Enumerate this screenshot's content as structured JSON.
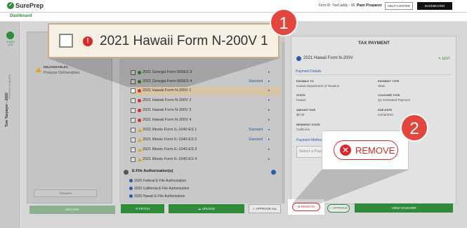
{
  "header": {
    "logo": "SurePrep",
    "firm_info": "Firm ID: TaxCaddy - 06",
    "user": "Pam Preparer",
    "help_center": "HELP CENTER",
    "dashboard": "DASHBOARD"
  },
  "subnav": {
    "dashboard_tab": "Dashboard"
  },
  "rail": {
    "client_list": "CLIENT LIST",
    "taxpayer": "Tom Taxpayer - 2020",
    "vertical_small": "PRINTING CHANGED"
  },
  "left": {
    "deliverables_title": "DELIVERABLES",
    "deliverables_sub": "Prepare Deliverables",
    "spinner_btn": "SPINNER",
    "deliver_btn": "DELIVER"
  },
  "list": {
    "rows": [
      {
        "label": "2021 Georgia Form 500ES 3",
        "status": "green",
        "std": "",
        "arrow": "▸"
      },
      {
        "label": "2021 Georgia Form 500ES 4",
        "status": "green",
        "std": "Standard",
        "arrow": "▸"
      },
      {
        "label": "2021 Hawaii Form N-200V 1",
        "status": "red",
        "std": "",
        "arrow": "▸"
      },
      {
        "label": "2021 Hawaii Form N-200V 2",
        "status": "red",
        "std": "",
        "arrow": "▸"
      },
      {
        "label": "2021 Hawaii Form N-200V 3",
        "status": "red",
        "std": "",
        "arrow": "▸"
      },
      {
        "label": "2021 Hawaii Form N-200V 4",
        "status": "red",
        "std": "",
        "arrow": "▸"
      },
      {
        "label": "2021 Illinois Form IL-1040-ES 1",
        "status": "warn",
        "std": "Standard",
        "arrow": "▸"
      },
      {
        "label": "2021 Illinois Form IL-1040-ES 2",
        "status": "warn",
        "std": "Standard",
        "arrow": "▸"
      },
      {
        "label": "2021 Illinois Form IL-1040-ES 3",
        "status": "warn",
        "std": "",
        "arrow": "▸"
      },
      {
        "label": "2021 Illinois Form IL-1040-ES 4",
        "status": "warn",
        "std": "",
        "arrow": "▸"
      }
    ],
    "efile_header": "E-File Authorization(s)",
    "efile_rows": [
      "2020 Federal E-File Authorization",
      "2020 California E-File Authorization",
      "2020 Hawaii E-File Authorization"
    ],
    "fetch": "FETCH",
    "upload": "UPLOAD",
    "approve_all": "APPROVE ALL"
  },
  "panel": {
    "title": "TAX PAYMENT",
    "form": "2021 Hawaii Form N-200V",
    "edit": "EDIT",
    "section": "Payment Details",
    "fields": [
      {
        "label": "PAYABLE TO",
        "value": "Hawaii Department of Taxation"
      },
      {
        "label": "PAYMENT TYPE",
        "value": "State"
      },
      {
        "label": "STATE",
        "value": "Hawaii"
      },
      {
        "label": "VOUCHER TYPE",
        "value": "Q1 Estimated Payment"
      },
      {
        "label": "AMOUNT DUE",
        "value": "$0.00"
      },
      {
        "label": "DUE DATE",
        "value": "04/15/2021"
      },
      {
        "label": "RESIDENT STATE",
        "value": "California"
      }
    ],
    "payment_method_label": "Payment Method",
    "payment_method_placeholder": "Select a Payment Method",
    "remove": "REMOVE",
    "approve": "APPROVE",
    "view_voucher": "VIEW VOUCHER"
  },
  "callouts": {
    "one_number": "1",
    "one_text": "2021 Hawaii Form N-200V 1",
    "two_number": "2",
    "two_text": "REMOVE"
  },
  "colors": {
    "accent_green": "#2e8b3a",
    "error_red": "#d62a2a",
    "callout_badge": "#e2463c"
  }
}
